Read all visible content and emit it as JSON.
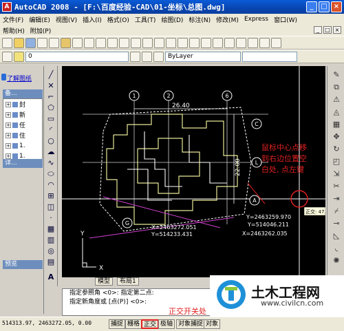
{
  "window": {
    "title": "AutoCAD 2008 - [F:\\百度经验-CAD\\01-坐标\\总图.dwg]",
    "app_icon": "A",
    "buttons": [
      "_",
      "□",
      "×"
    ]
  },
  "menu": {
    "row1": [
      "文件(F)",
      "编辑(E)",
      "视图(V)",
      "插入(I)",
      "格式(O)",
      "工具(T)",
      "绘图(D)",
      "标注(N)",
      "修改(M)",
      "Express",
      "窗口(W)"
    ],
    "row2": [
      "帮助(H)",
      "附加(P)"
    ],
    "mdi_buttons": [
      "_",
      "□",
      "×"
    ]
  },
  "toolbar": {
    "layer_combo": "0",
    "color_combo": "ByLayer"
  },
  "left_panel": {
    "link": "了解图纸",
    "section1_title": "备...",
    "tree": [
      "封",
      "新",
      "任",
      "住",
      "1.",
      "1.",
      "任"
    ],
    "section2_title": "详...",
    "section3_title": "预览"
  },
  "canvas": {
    "dim_top": "26.40",
    "dim_side": "22.00",
    "grid_labels": [
      "1",
      "2",
      "6",
      "C",
      "L",
      "A",
      "G"
    ],
    "coord_labels": [
      "X=2463272.051",
      "Y=514233.431",
      "Y=514046.211",
      "Y=2463259.970",
      "X=2463262.035"
    ],
    "annotation": [
      "鼠标中心点移",
      "到右边位置空",
      "白处, 点左键"
    ],
    "ortho_tooltip": "正交: 47.16",
    "ucs_x": "X",
    "ucs_y": "Y"
  },
  "tabs": {
    "model": "模型",
    "layout": "布局1"
  },
  "command": {
    "line1": "指定参照角 <0>: 指定第二点:",
    "line2": "指定新角度或 [点(P)] <0>:",
    "annotation": "正交开关处"
  },
  "status": {
    "coords": "514313.97, 2463272.05, 0.00",
    "buttons": [
      "捕捉",
      "栅格",
      "正交",
      "极轴",
      "对象捕捉",
      "对象"
    ]
  },
  "watermark": {
    "cn": "土木工程网",
    "url": "www.civilcn.com"
  },
  "colors": {
    "highlight_red": "#e02020",
    "canvas_bg": "#000000",
    "titlebar_blue": "#0a5bd8"
  }
}
